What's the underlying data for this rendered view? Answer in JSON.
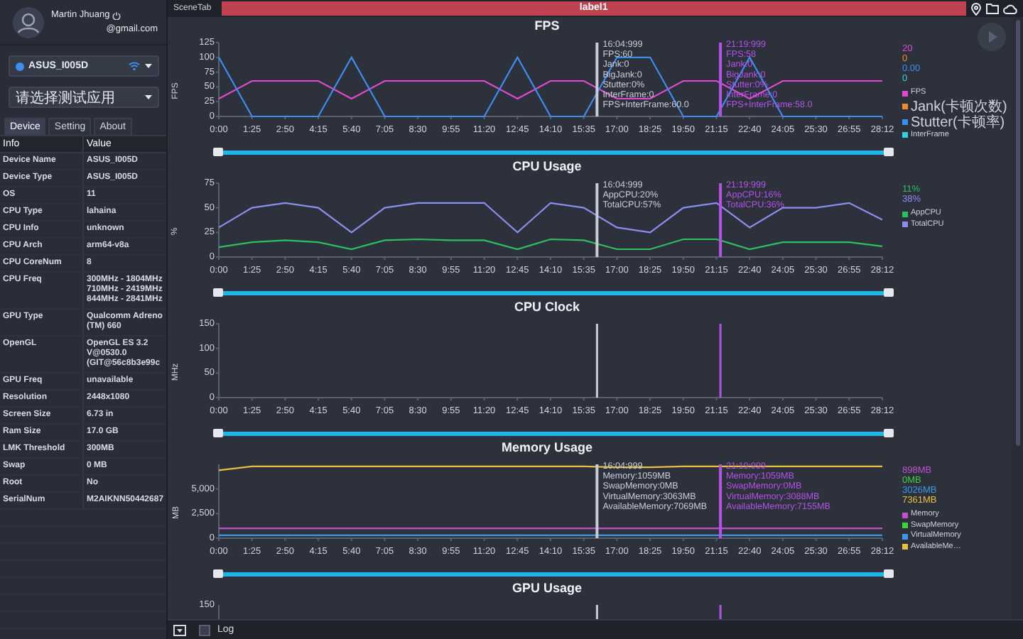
{
  "user": {
    "name": "Martin Jhuang",
    "email": "@gmail.com"
  },
  "device_select": {
    "value": "ASUS_I005D"
  },
  "app_select": {
    "placeholder": "请选择测试应用"
  },
  "tabs": [
    {
      "label": "Device",
      "selected": true
    },
    {
      "label": "Setting",
      "selected": false
    },
    {
      "label": "About",
      "selected": false
    }
  ],
  "info_table": {
    "columns": [
      "Info",
      "Value"
    ],
    "rows": [
      [
        "Device Name",
        "ASUS_I005D"
      ],
      [
        "Device Type",
        "ASUS_I005D"
      ],
      [
        "OS",
        "11"
      ],
      [
        "CPU Type",
        "lahaina"
      ],
      [
        "CPU Info",
        "unknown"
      ],
      [
        "CPU Arch",
        "arm64-v8a"
      ],
      [
        "CPU CoreNum",
        "8"
      ],
      [
        "CPU Freq",
        "300MHz - 1804MHz\n710MHz - 2419MHz\n844MHz - 2841MHz"
      ],
      [
        "GPU Type",
        "Qualcomm Adreno\n(TM) 660"
      ],
      [
        "OpenGL",
        "OpenGL ES 3.2\nV@0530.0\n(GIT@56c8b3e99c"
      ],
      [
        "GPU Freq",
        "unavailable"
      ],
      [
        "Resolution",
        "2448x1080"
      ],
      [
        "Screen Size",
        "6.73 in"
      ],
      [
        "Ram Size",
        "17.0 GB"
      ],
      [
        "LMK Threshold",
        "300MB"
      ],
      [
        "Swap",
        "0 MB"
      ],
      [
        "Root",
        "No"
      ],
      [
        "SerialNum",
        "M2AIKNN50442687"
      ]
    ]
  },
  "scene_bar": {
    "label": "SceneTab",
    "tab": "label1"
  },
  "charts": [
    {
      "chart_data": {
        "type": "line",
        "title": "FPS",
        "ylabel": "FPS",
        "ylim": [
          0,
          125
        ],
        "yticks": [
          0,
          25,
          50,
          75,
          100,
          125
        ],
        "categories": [
          "0:00",
          "1:25",
          "2:50",
          "4:15",
          "5:40",
          "7:05",
          "8:30",
          "9:55",
          "11:20",
          "12:45",
          "14:10",
          "15:35",
          "17:00",
          "18:25",
          "19:50",
          "21:15",
          "22:40",
          "24:05",
          "25:30",
          "26:55",
          "28:12"
        ],
        "series": [
          {
            "name": "FPS",
            "color": "#e04ad0",
            "values": [
              30,
              60,
              60,
              60,
              30,
              60,
              60,
              60,
              60,
              30,
              60,
              60,
              30,
              30,
              60,
              60,
              30,
              60,
              60,
              60,
              60
            ]
          },
          {
            "name": "Stutter(卡顿率)",
            "color": "#3c8ff0",
            "values": [
              100,
              0,
              0,
              0,
              100,
              0,
              0,
              0,
              0,
              100,
              0,
              0,
              100,
              100,
              0,
              0,
              100,
              0,
              0,
              0,
              0
            ]
          }
        ]
      },
      "readings": [
        {
          "text": "20",
          "color": "#e04ad0"
        },
        {
          "text": "0",
          "color": "#f08a30"
        },
        {
          "text": "0.00",
          "color": "#3c8ff0"
        },
        {
          "text": "0",
          "color": "#30d0e0"
        }
      ],
      "legend": [
        {
          "kind": "series"
        },
        {
          "kind": "extra",
          "name": "Jank(卡顿次数)",
          "color": "#f08a30"
        },
        {
          "kind": "series"
        },
        {
          "kind": "extra",
          "name": "InterFrame",
          "color": "#30d0e0"
        }
      ],
      "cursors": [
        {
          "color": "#c8ccd6",
          "lines": [
            "16:04:999",
            "FPS:60",
            "Jank:0",
            "BigJank:0",
            "Stutter:0%",
            "InterFrame:0",
            "FPS+InterFrame:60.0"
          ]
        },
        {
          "color": "#b452e6",
          "lines": [
            "21:19:999",
            "FPS:58",
            "Jank:0",
            "BigJank:0",
            "Stutter:0%",
            "InterFrame:0",
            "FPS+InterFrame:58.0"
          ]
        }
      ]
    },
    {
      "chart_data": {
        "type": "line",
        "title": "CPU Usage",
        "ylabel": "%",
        "ylim": [
          0,
          75
        ],
        "yticks": [
          0,
          25,
          50,
          75
        ],
        "categories": [
          "0:00",
          "1:25",
          "2:50",
          "4:15",
          "5:40",
          "7:05",
          "8:30",
          "9:55",
          "11:20",
          "12:45",
          "14:10",
          "15:35",
          "17:00",
          "18:25",
          "19:50",
          "21:15",
          "22:40",
          "24:05",
          "25:30",
          "26:55",
          "28:12"
        ],
        "series": [
          {
            "name": "AppCPU",
            "color": "#2ec060",
            "values": [
              10,
              15,
              17,
              15,
              8,
              17,
              18,
              17,
              17,
              8,
              18,
              17,
              8,
              8,
              18,
              18,
              8,
              15,
              15,
              15,
              11
            ]
          },
          {
            "name": "TotalCPU",
            "color": "#8a8ff0",
            "values": [
              30,
              50,
              55,
              50,
              25,
              50,
              55,
              55,
              55,
              25,
              55,
              50,
              30,
              25,
              50,
              55,
              30,
              50,
              50,
              55,
              38
            ]
          }
        ]
      },
      "readings": [
        {
          "text": "11%",
          "color": "#2ec060"
        },
        {
          "text": "38%",
          "color": "#8a8ff0"
        }
      ],
      "legend": [
        {
          "kind": "series"
        },
        {
          "kind": "series"
        }
      ],
      "cursors": [
        {
          "color": "#c8ccd6",
          "lines": [
            "16:04:999",
            "AppCPU:20%",
            "TotalCPU:57%"
          ]
        },
        {
          "color": "#b452e6",
          "lines": [
            "21:19:999",
            "AppCPU:16%",
            "TotalCPU:36%"
          ]
        }
      ]
    },
    {
      "chart_data": {
        "type": "line",
        "title": "CPU Clock",
        "ylabel": "MHz",
        "ylim": [
          0,
          150
        ],
        "yticks": [
          0,
          50,
          100,
          150
        ],
        "categories": [
          "0:00",
          "1:25",
          "2:50",
          "4:15",
          "5:40",
          "7:05",
          "8:30",
          "9:55",
          "11:20",
          "12:45",
          "14:10",
          "15:35",
          "17:00",
          "18:25",
          "19:50",
          "21:15",
          "22:40",
          "24:05",
          "25:30",
          "26:55",
          "28:12"
        ]
      },
      "cursor_lines": true
    },
    {
      "chart_data": {
        "type": "line",
        "title": "Memory Usage",
        "ylabel": "MB",
        "ylim": [
          0,
          7500
        ],
        "yticks": [
          0,
          {
            "value": 2500,
            "label": "2,500"
          },
          {
            "value": 5000,
            "label": "5,000"
          }
        ],
        "categories": [
          "0:00",
          "1:25",
          "2:50",
          "4:15",
          "5:40",
          "7:05",
          "8:30",
          "9:55",
          "11:20",
          "12:45",
          "14:10",
          "15:35",
          "17:00",
          "18:25",
          "19:50",
          "21:15",
          "22:40",
          "24:05",
          "25:30",
          "26:55",
          "28:12"
        ],
        "series": [
          {
            "name": "Memory",
            "color": "#c050d0",
            "values": [
              1000,
              1000,
              1000,
              1000,
              1000,
              1000,
              1000,
              1000,
              1000,
              1000,
              1000,
              1000,
              1000,
              1000,
              1000,
              1000,
              1000,
              1000,
              1000,
              1000,
              1000
            ]
          },
          {
            "name": "VirtualMemory",
            "color": "#3a9ae8",
            "values": [
              300,
              300,
              300,
              300,
              300,
              300,
              300,
              300,
              300,
              300,
              300,
              300,
              300,
              300,
              300,
              300,
              300,
              300,
              300,
              300,
              300
            ]
          },
          {
            "name": "AvailableMe…",
            "color": "#e8c040",
            "values": [
              6900,
              7300,
              7300,
              7300,
              7300,
              7300,
              7300,
              7300,
              7300,
              7300,
              7300,
              7300,
              7200,
              7200,
              7300,
              7300,
              7300,
              7300,
              7300,
              7300,
              7300
            ]
          }
        ]
      },
      "readings": [
        {
          "text": "898MB",
          "color": "#c050d0"
        },
        {
          "text": "0MB",
          "color": "#40d040"
        },
        {
          "text": "3026MB",
          "color": "#3a9ae8"
        },
        {
          "text": "7361MB",
          "color": "#e8c040"
        }
      ],
      "legend": [
        {
          "kind": "series"
        },
        {
          "kind": "extra",
          "name": "SwapMemory",
          "color": "#40d040"
        },
        {
          "kind": "series"
        },
        {
          "kind": "series"
        }
      ],
      "cursors": [
        {
          "color": "#c8ccd6",
          "lines": [
            "16:04:999",
            "Memory:1059MB",
            "SwapMemory:0MB",
            "VirtualMemory:3063MB",
            "AvailableMemory:7069MB"
          ]
        },
        {
          "color": "#b452e6",
          "lines": [
            "21:19:999",
            "Memory:1059MB",
            "SwapMemory:0MB",
            "VirtualMemory:3088MB",
            "AvailableMemory:7155MB"
          ]
        }
      ]
    },
    {
      "title": "GPU Usage",
      "axis_label": "150",
      "cursor_lines": true
    }
  ],
  "log": {
    "label": "Log",
    "checked": false
  }
}
